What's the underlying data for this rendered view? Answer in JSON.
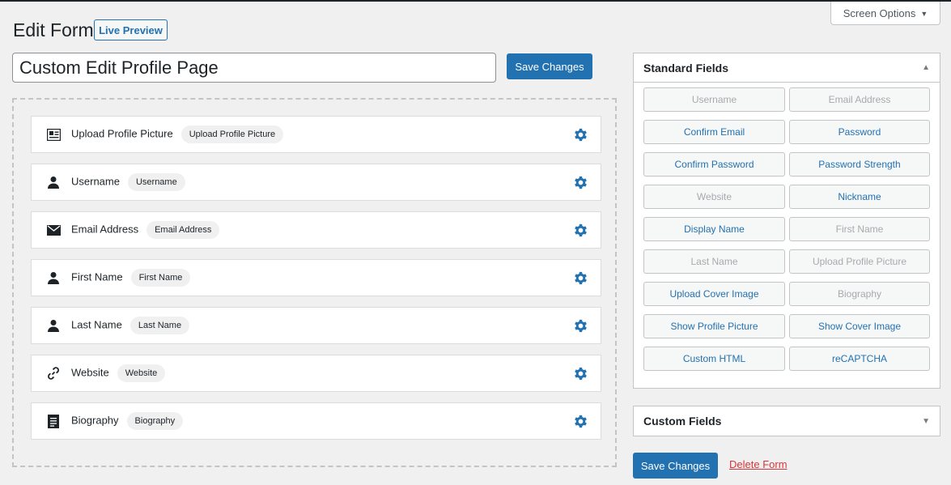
{
  "screen_options": {
    "label": "Screen Options"
  },
  "header": {
    "title": "Edit Form",
    "live_preview": "Live Preview"
  },
  "form": {
    "title_value": "Custom Edit Profile Page",
    "save_label": "Save Changes"
  },
  "fields": [
    {
      "label": "Upload Profile Picture",
      "tag": "Upload Profile Picture",
      "icon": "id-card-icon"
    },
    {
      "label": "Username",
      "tag": "Username",
      "icon": "user-icon"
    },
    {
      "label": "Email Address",
      "tag": "Email Address",
      "icon": "envelope-icon"
    },
    {
      "label": "First Name",
      "tag": "First Name",
      "icon": "user-icon"
    },
    {
      "label": "Last Name",
      "tag": "Last Name",
      "icon": "user-icon"
    },
    {
      "label": "Website",
      "tag": "Website",
      "icon": "link-icon"
    },
    {
      "label": "Biography",
      "tag": "Biography",
      "icon": "document-icon"
    }
  ],
  "standard_fields": {
    "title": "Standard Fields",
    "buttons": [
      {
        "label": "Username",
        "enabled": false
      },
      {
        "label": "Email Address",
        "enabled": false
      },
      {
        "label": "Confirm Email",
        "enabled": true
      },
      {
        "label": "Password",
        "enabled": true
      },
      {
        "label": "Confirm Password",
        "enabled": true
      },
      {
        "label": "Password Strength",
        "enabled": true
      },
      {
        "label": "Website",
        "enabled": false
      },
      {
        "label": "Nickname",
        "enabled": true
      },
      {
        "label": "Display Name",
        "enabled": true
      },
      {
        "label": "First Name",
        "enabled": false
      },
      {
        "label": "Last Name",
        "enabled": false
      },
      {
        "label": "Upload Profile Picture",
        "enabled": false
      },
      {
        "label": "Upload Cover Image",
        "enabled": true
      },
      {
        "label": "Biography",
        "enabled": false
      },
      {
        "label": "Show Profile Picture",
        "enabled": true
      },
      {
        "label": "Show Cover Image",
        "enabled": true
      },
      {
        "label": "Custom HTML",
        "enabled": true
      },
      {
        "label": "reCAPTCHA",
        "enabled": true
      }
    ]
  },
  "custom_fields": {
    "title": "Custom Fields"
  },
  "footer": {
    "save_label": "Save Changes",
    "delete_label": "Delete Form"
  },
  "colors": {
    "accent": "#2271b1",
    "danger": "#d63638",
    "disabled": "#a7aaad"
  }
}
